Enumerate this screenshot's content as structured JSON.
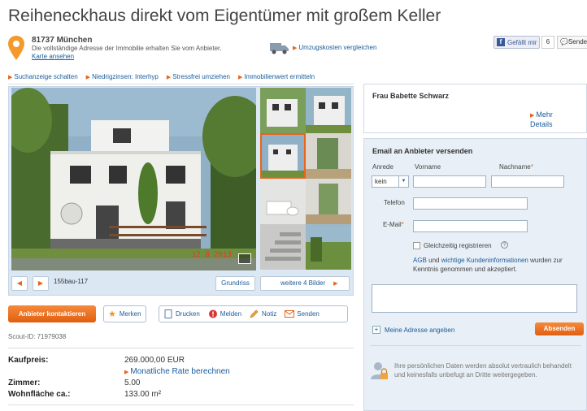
{
  "title": "Reiheneckhaus direkt vom Eigentümer mit großem Keller",
  "location": {
    "city": "81737 München",
    "note": "Die vollständige Adresse der Immobilie erhalten Sie vom Anbieter.",
    "map_link": "Karte ansehen",
    "move_costs": "Umzugskosten vergleichen"
  },
  "social": {
    "like_label": "Gefällt mir",
    "like_count": "6",
    "share_label": "Senden"
  },
  "quicklinks": [
    "Suchanzeige schalten",
    "Niedrigzinsen: Interhyp",
    "Stressfrei umziehen",
    "Immobilienwert ermitteln"
  ],
  "gallery": {
    "photo_date": "12 8 2013",
    "caption": "155bau-117",
    "floorplan_label": "Grundriss",
    "more_label": "weitere 4 Bilder",
    "prev_label": "◀",
    "next_label": "▶"
  },
  "actions": {
    "contact": "Anbieter kontaktieren",
    "bookmark": "Merken",
    "print": "Drucken",
    "report": "Melden",
    "note": "Notiz",
    "send": "Senden"
  },
  "scout_id": "Scout-ID: 71979038",
  "facts": [
    {
      "label": "Kaufpreis:",
      "value": "269.000,00 EUR"
    },
    {
      "label": "Zimmer:",
      "value": "5.00"
    },
    {
      "label": "Wohnfläche ca.:",
      "value": "133.00 m²"
    }
  ],
  "rate_link": "Monatliche Rate berechnen",
  "agent": {
    "name": "Frau Babette Schwarz",
    "more_line1": "Mehr",
    "more_line2": "Details"
  },
  "form": {
    "title": "Email an Anbieter versenden",
    "salutation_label": "Anrede",
    "salutation_value": "kein",
    "firstname_label": "Vorname",
    "lastname_label": "Nachname",
    "phone_label": "Telefon",
    "email_label": "E-Mail",
    "register_label": "Gleichzeitig registrieren",
    "info_glyph": "?",
    "agb_prefix": "AGB",
    "agb_and": " und ",
    "agb_link": "wichtige Kundeninformationen",
    "agb_suffix": " wurden zur Kenntnis genommen und akzeptiert.",
    "address_toggle": "Meine Adresse angeben",
    "plus_glyph": "+",
    "submit": "Absenden",
    "privacy": "Ihre persönlichen Daten werden absolut vertraulich behandelt und keinesfalls unbefugt an Dritte weitergegeben."
  },
  "colors": {
    "accent": "#e8641b",
    "link": "#1a5b9a",
    "panel": "#e8eff6"
  }
}
